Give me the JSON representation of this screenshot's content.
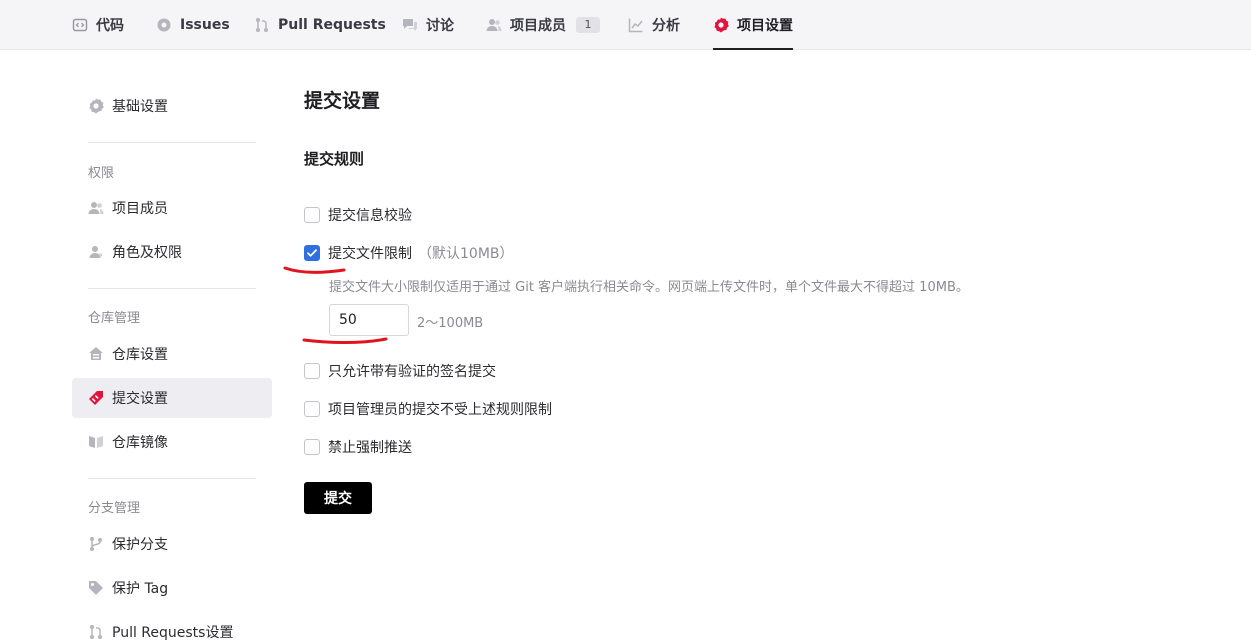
{
  "topnav": {
    "tabs": [
      {
        "label": "代码",
        "icon": "code-icon"
      },
      {
        "label": "Issues",
        "icon": "issue-icon"
      },
      {
        "label": "Pull Requests",
        "icon": "pull-request-icon"
      },
      {
        "label": "讨论",
        "icon": "discussion-icon"
      },
      {
        "label": "项目成员",
        "icon": "members-icon",
        "badge": "1"
      },
      {
        "label": "分析",
        "icon": "chart-icon"
      },
      {
        "label": "项目设置",
        "icon": "settings-gear-icon",
        "active": true
      }
    ]
  },
  "sidebar": {
    "basic": {
      "label": "基础设置",
      "icon": "gear-icon"
    },
    "groups": {
      "permissions": "权限",
      "repo": "仓库管理",
      "branch": "分支管理"
    },
    "items": {
      "members": "项目成员",
      "roles": "角色及权限",
      "repo_settings": "仓库设置",
      "commit_settings": "提交设置",
      "mirror": "仓库镜像",
      "protected_branch": "保护分支",
      "protected_tag": "保护 Tag",
      "pr_settings": "Pull Requests设置"
    },
    "active_item": "commit_settings"
  },
  "main": {
    "title": "提交设置",
    "section_title": "提交规则",
    "options": {
      "message_check": {
        "label": "提交信息校验",
        "checked": false
      },
      "file_limit": {
        "label": "提交文件限制",
        "note": "（默认10MB）",
        "checked": true
      },
      "signed_only": {
        "label": "只允许带有验证的签名提交",
        "checked": false
      },
      "admin_exempt": {
        "label": "项目管理员的提交不受上述规则限制",
        "checked": false
      },
      "no_force_push": {
        "label": "禁止强制推送",
        "checked": false
      }
    },
    "file_limit_help": "提交文件大小限制仅适用于通过 Git 客户端执行相关命令。网页端上传文件时，单个文件最大不得超过 10MB。",
    "file_limit_value": "50",
    "file_limit_range": "2～100MB",
    "submit_label": "提交"
  },
  "colors": {
    "accent_checkbox": "#2f6fe0",
    "active_settings_icon": "#e0143c",
    "annotation": "#e0141e"
  }
}
